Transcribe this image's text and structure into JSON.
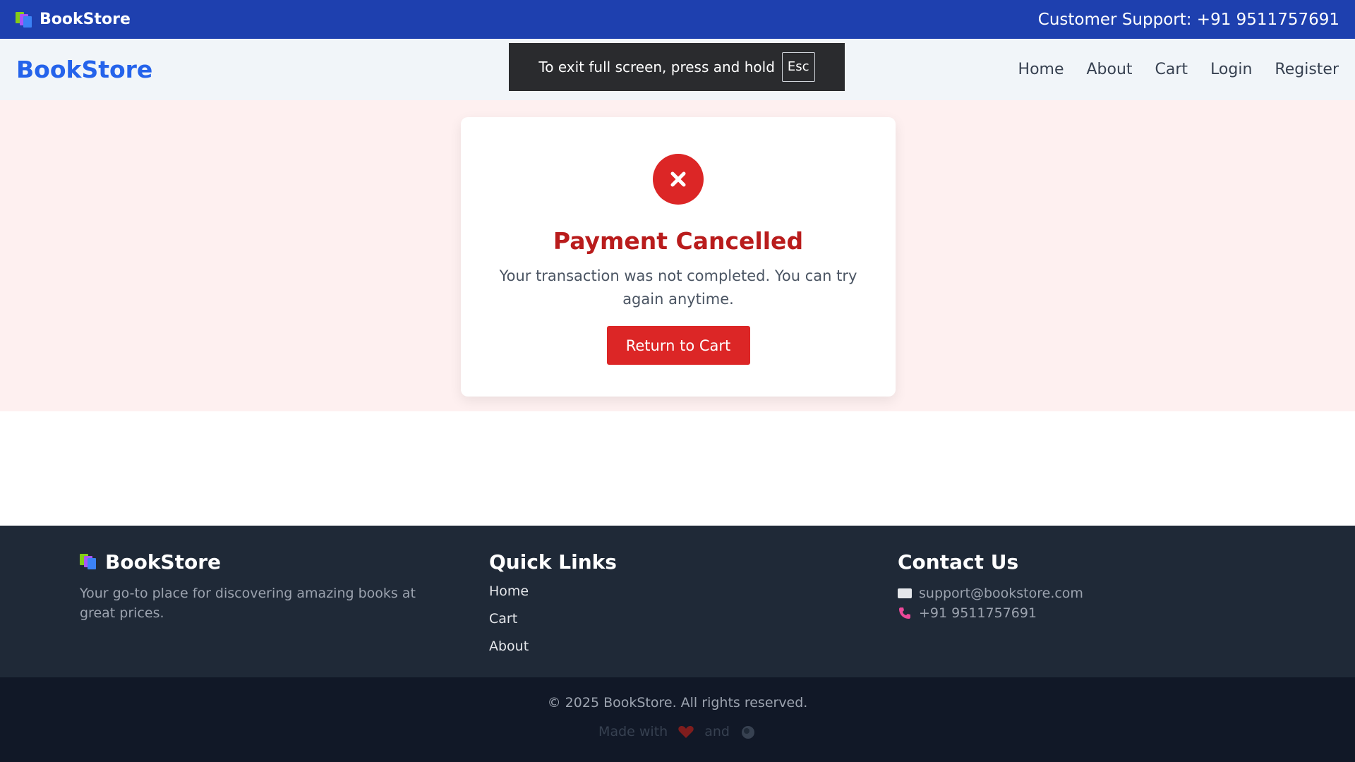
{
  "topbar": {
    "brand": "BookStore",
    "support": "Customer Support: +91 9511757691"
  },
  "navbar": {
    "brand": "BookStore",
    "links": [
      "Home",
      "About",
      "Cart",
      "Login",
      "Register"
    ]
  },
  "fullscreen_notice": {
    "text": "To exit full screen, press and hold",
    "key": "Esc"
  },
  "card": {
    "icon": "x-circle-icon",
    "title": "Payment Cancelled",
    "message": "Your transaction was not completed. You can try again anytime.",
    "button": "Return to Cart"
  },
  "footer": {
    "brand": "BookStore",
    "tagline": "Your go-to place for discovering amazing books at great prices.",
    "quick_links_title": "Quick Links",
    "quick_links": [
      "Home",
      "Cart",
      "About"
    ],
    "contact_title": "Contact Us",
    "email": "support@bookstore.com",
    "phone": "+91 9511757691"
  },
  "bottom": {
    "copyright": "© 2025 BookStore. All rights reserved.",
    "made_with": "Made with",
    "and": "and"
  },
  "colors": {
    "topbar": "#1e40af",
    "brand": "#2563eb",
    "danger": "#dc2626",
    "hero_bg": "#fef0f0",
    "footer": "#1f2937",
    "bottom": "#111827"
  }
}
